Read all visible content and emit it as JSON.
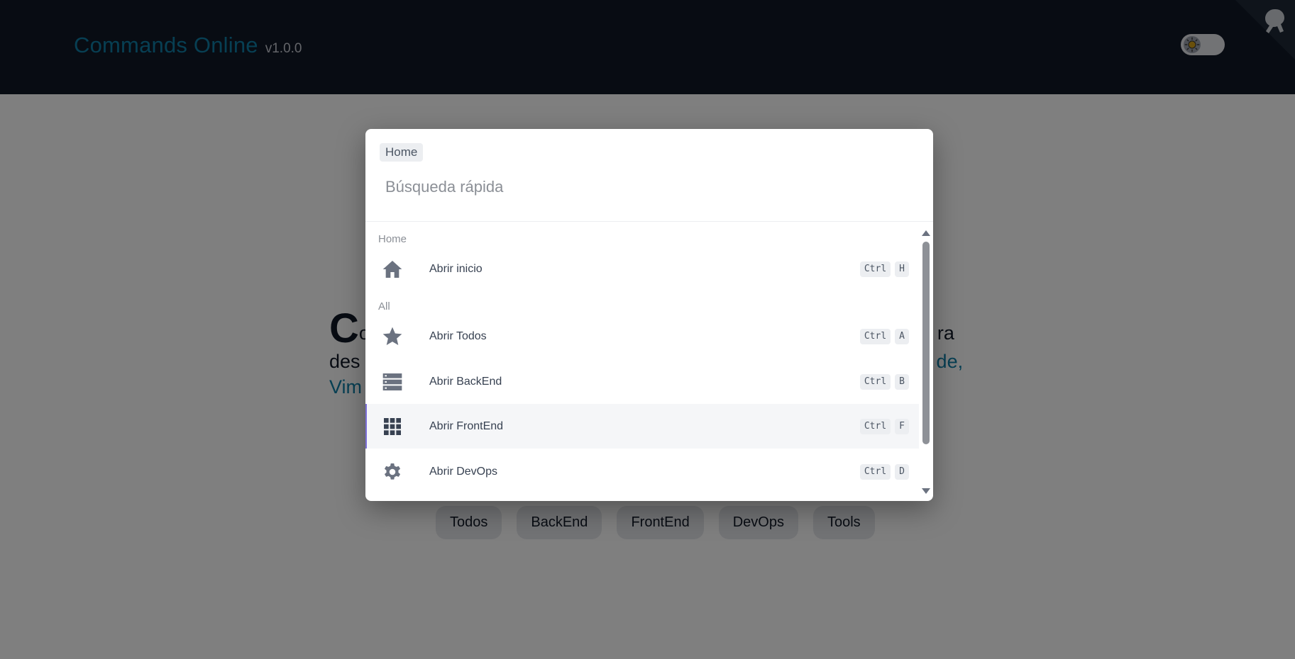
{
  "header": {
    "title": "Commands Online",
    "version": "v1.0.0",
    "theme_toggle_icon": "sun-icon",
    "corner_icon": "github-octocat-icon"
  },
  "hero": {
    "line1_initial": "C",
    "line1_rest": "o",
    "line1_tail": "ra",
    "line2_start": "des",
    "line2_link_tail": "de,",
    "line3_link_start": "Vim"
  },
  "categories": [
    "Todos",
    "BackEnd",
    "FrontEnd",
    "DevOps",
    "Tools"
  ],
  "palette": {
    "breadcrumb": "Home",
    "search_placeholder": "Búsqueda rápida",
    "sections": [
      {
        "label": "Home",
        "items": [
          {
            "label": "Abrir inicio",
            "icon": "home-icon",
            "keys": [
              "Ctrl",
              "H"
            ]
          }
        ]
      },
      {
        "label": "All",
        "items": [
          {
            "label": "Abrir Todos",
            "icon": "star-icon",
            "keys": [
              "Ctrl",
              "A"
            ]
          },
          {
            "label": "Abrir BackEnd",
            "icon": "server-icon",
            "keys": [
              "Ctrl",
              "B"
            ]
          },
          {
            "label": "Abrir FrontEnd",
            "icon": "apps-grid-icon",
            "keys": [
              "Ctrl",
              "F"
            ],
            "selected": true
          },
          {
            "label": "Abrir DevOps",
            "icon": "gear-icon",
            "keys": [
              "Ctrl",
              "D"
            ]
          }
        ]
      }
    ]
  },
  "colors": {
    "header_bg": "#111827",
    "brand": "#0e7fa6",
    "selected_accent": "#7c6fd8",
    "icon": "#6b7280"
  }
}
